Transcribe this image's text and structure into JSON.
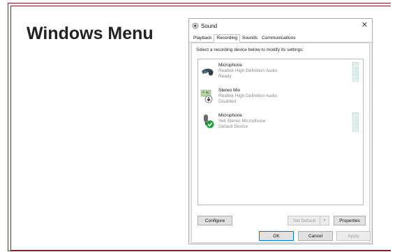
{
  "slide": {
    "heading": "Windows Menu"
  },
  "dialog": {
    "title": "Sound",
    "tabs": [
      {
        "label": "Playback",
        "active": false
      },
      {
        "label": "Recording",
        "active": true
      },
      {
        "label": "Sounds",
        "active": false
      },
      {
        "label": "Communications",
        "active": false
      }
    ],
    "instruction": "Select a recording device below to modify its settings:",
    "devices": [
      {
        "name": "Microphone",
        "driver": "Realtek High Definition Audio",
        "status": "Ready",
        "icon": "headset-microphone-icon",
        "has_meter": true
      },
      {
        "name": "Stereo Mix",
        "driver": "Realtek High Definition Audio",
        "status": "Disabled",
        "icon": "circuit-board-disabled-icon",
        "has_meter": false
      },
      {
        "name": "Microphone",
        "driver": "Yeti Stereo Microphone",
        "status": "Default Device",
        "icon": "microphone-default-check-icon",
        "has_meter": true
      }
    ],
    "buttons": {
      "configure": "Configure",
      "set_default": "Set Default",
      "properties": "Properties",
      "ok": "OK",
      "cancel": "Cancel",
      "apply": "Apply"
    },
    "colors": {
      "check_green": "#1e9e3c",
      "frame_red": "#8a1f1f"
    }
  }
}
